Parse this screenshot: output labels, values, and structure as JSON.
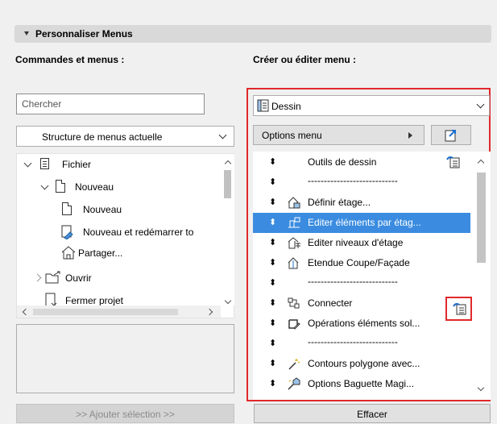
{
  "section": {
    "title": "Personnaliser Menus"
  },
  "left": {
    "heading": "Commandes et menus :",
    "search_placeholder": "Chercher",
    "structure_select": "Structure de menus actuelle",
    "tree": [
      {
        "label": "Fichier",
        "level": 0,
        "expander": "expanded",
        "icon": "document-list-icon"
      },
      {
        "label": "Nouveau",
        "level": 1,
        "expander": "expanded",
        "icon": "document-icon"
      },
      {
        "label": "Nouveau",
        "level": 2,
        "expander": "none",
        "icon": "document-icon"
      },
      {
        "label": "Nouveau et redémarrer to",
        "level": 2,
        "expander": "none",
        "icon": "new-restart-icon"
      },
      {
        "label": "Partager...",
        "level": 2,
        "expander": "none",
        "icon": "share-house-icon"
      },
      {
        "label": "Ouvrir",
        "level": 1,
        "expander": "collapsed",
        "icon": "open-folder-icon"
      },
      {
        "label": "Fermer projet",
        "level": 1,
        "expander": "none",
        "icon": "close-document-icon"
      }
    ],
    "add_button": ">> Ajouter sélection >>"
  },
  "right": {
    "heading": "Créer ou éditer menu :",
    "menu_select": "Dessin",
    "options_label": "Options menu",
    "items": [
      {
        "label": "Outils de dessin",
        "icon": "",
        "submenu": true
      },
      {
        "label": "----------------------------",
        "icon": "",
        "submenu": false
      },
      {
        "label": "Définir étage...",
        "icon": "define-story-icon",
        "submenu": false
      },
      {
        "label": "Editer éléments par étag...",
        "icon": "edit-by-story-icon",
        "submenu": false,
        "selected": true
      },
      {
        "label": "Editer niveaux d'étage",
        "icon": "story-levels-icon",
        "submenu": false
      },
      {
        "label": "Etendue Coupe/Façade",
        "icon": "section-range-icon",
        "submenu": false
      },
      {
        "label": "----------------------------",
        "icon": "",
        "submenu": false
      },
      {
        "label": "Connecter",
        "icon": "connect-icon",
        "submenu": false,
        "submenu_marker": true
      },
      {
        "label": "Opérations éléments sol...",
        "icon": "solid-ops-icon",
        "submenu": false
      },
      {
        "label": "----------------------------",
        "icon": "",
        "submenu": false
      },
      {
        "label": "Contours polygone avec...",
        "icon": "magic-wand-icon",
        "submenu": false
      },
      {
        "label": "Options Baguette Magi...",
        "icon": "magic-wand-options-icon",
        "submenu": false
      }
    ],
    "clear_button": "Effacer",
    "highlight_color": "#e0292b",
    "selection_color": "#3b8ce0"
  }
}
